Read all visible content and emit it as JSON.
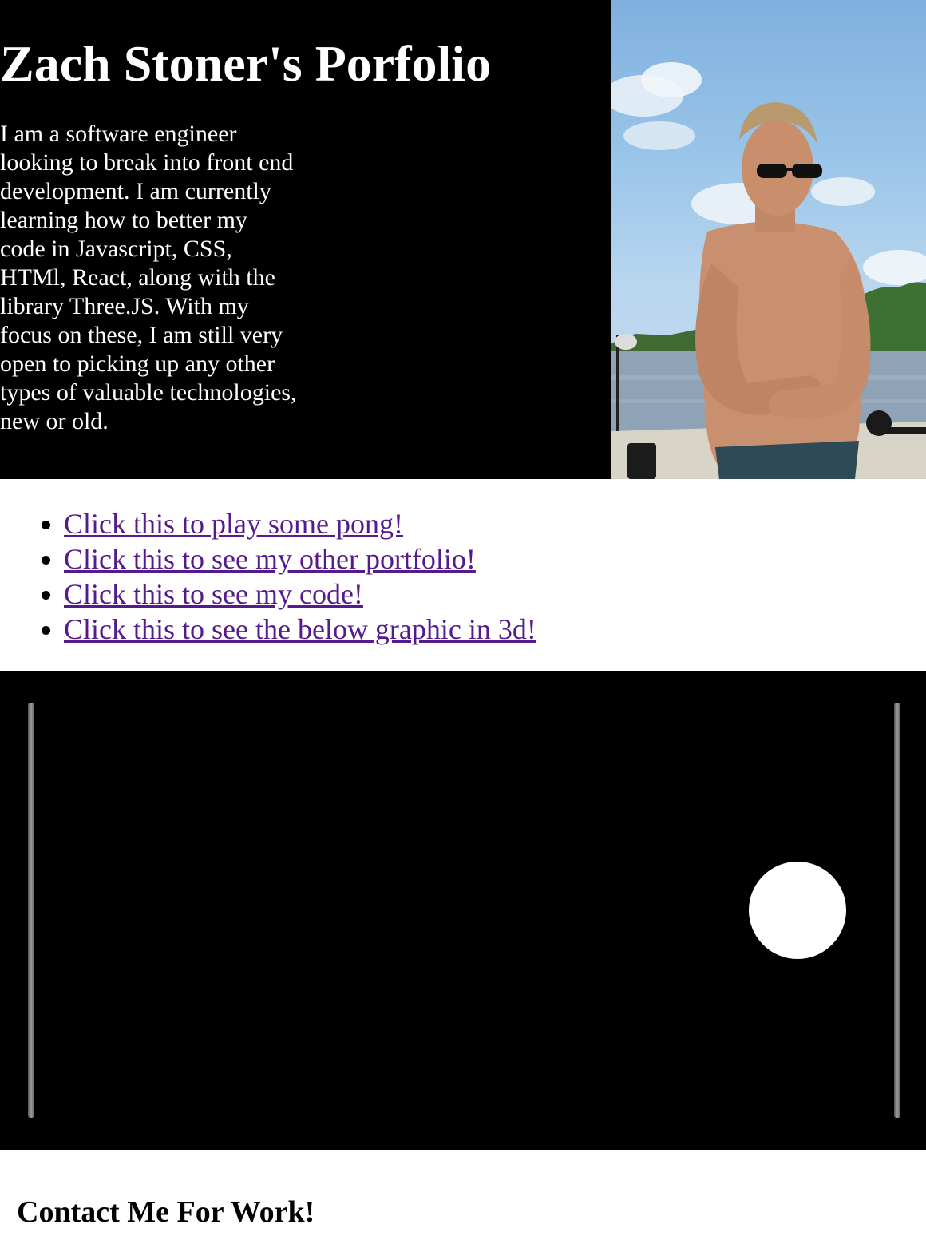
{
  "hero": {
    "title": "Zach Stoner's Porfolio",
    "bio": "I am a software engineer looking to break into front end development. I am currently learning how to better my code in Javascript, CSS, HTMl, React, along with the library Three.JS. With my focus on these, I am still very open to picking up any other types of valuable technologies, new or old."
  },
  "links": [
    {
      "label": "Click this to play some pong!"
    },
    {
      "label": "Click this to see my other portfolio!"
    },
    {
      "label": "Click this to see my code!"
    },
    {
      "label": "Click this to see the below graphic in 3d!"
    }
  ],
  "contact": {
    "heading": "Contact Me For Work!"
  },
  "colors": {
    "background": "#000000",
    "text": "#ffffff",
    "visited_link": "#551a8b",
    "paddle": "#8a8a8a",
    "ball": "#ffffff"
  }
}
